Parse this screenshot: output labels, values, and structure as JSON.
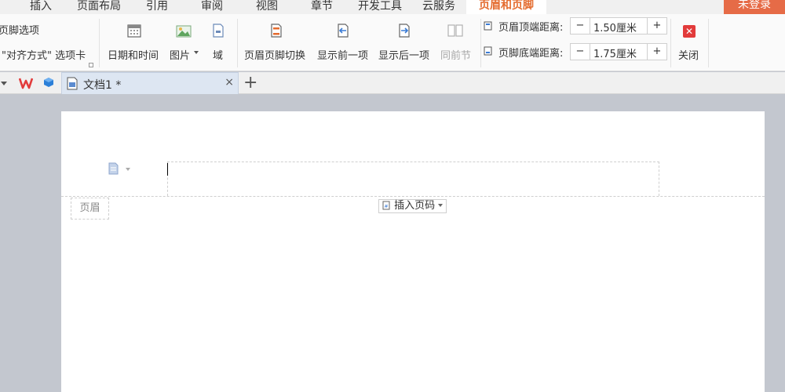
{
  "menu": {
    "tabs": [
      "插入",
      "页面布局",
      "引用",
      "审阅",
      "视图",
      "章节",
      "开发工具",
      "云服务",
      "页眉和页脚"
    ],
    "login": "未登录"
  },
  "ribbon": {
    "header_footer_options": "页脚选项",
    "align_tab": "\"对齐方式\" 选项卡",
    "date_time": "日期和时间",
    "picture": "图片",
    "field": "域",
    "switch": "页眉页脚切换",
    "prev": "显示前一项",
    "next": "显示后一项",
    "same_as_prev": "同前节",
    "header_top_label": "页眉顶端距离:",
    "header_top_value": "1.50厘米",
    "footer_bottom_label": "页脚底端距离:",
    "footer_bottom_value": "1.75厘米",
    "minus": "−",
    "plus": "+",
    "close": "关闭"
  },
  "tabs": {
    "doc_title": "文档1 *",
    "close": "×",
    "new": "+"
  },
  "page": {
    "header_tag": "页眉",
    "insert_page_num": "插入页码"
  },
  "colors": {
    "accent": "#e46b2e",
    "login_bg": "#e66b47",
    "close_red": "#e23b3b"
  }
}
